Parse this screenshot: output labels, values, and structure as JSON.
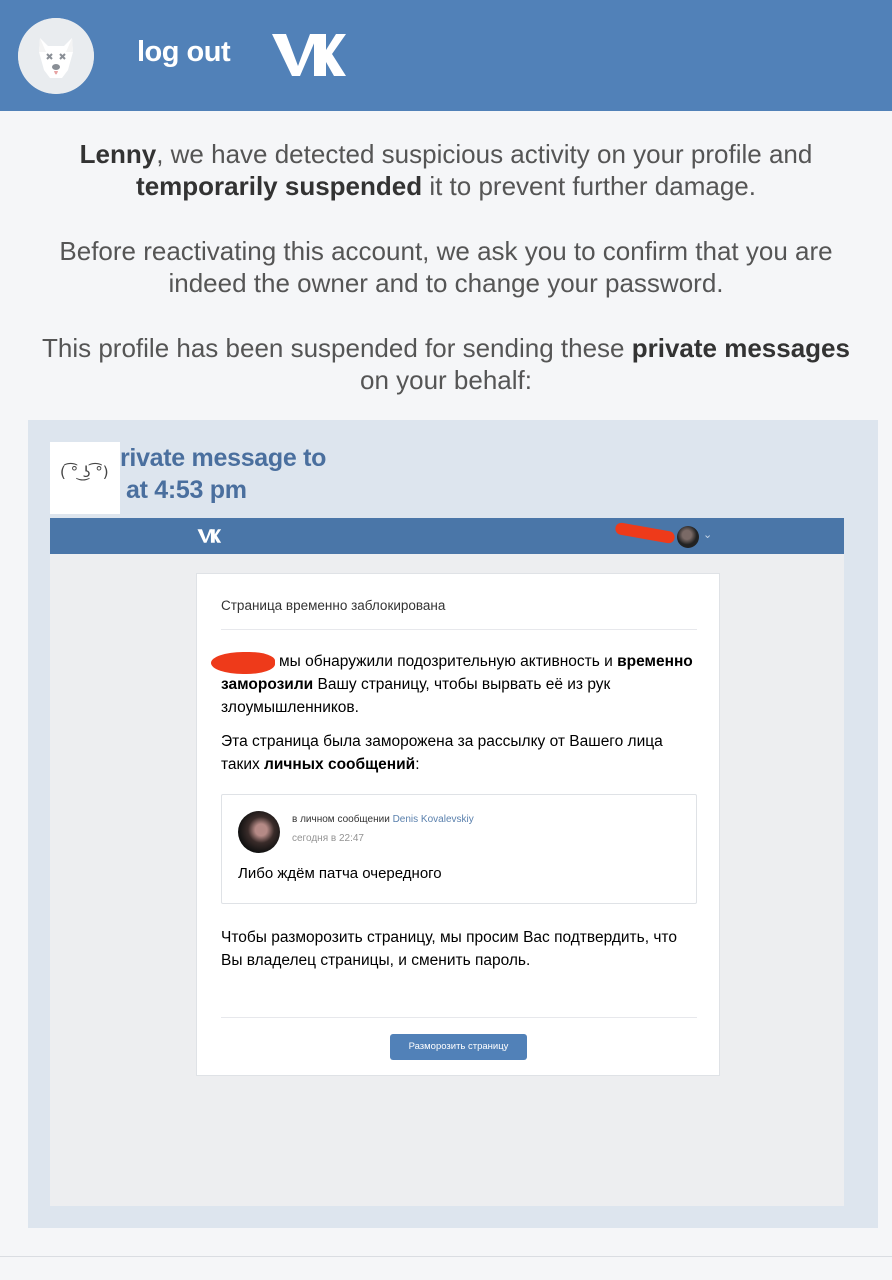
{
  "header": {
    "logout_label": "log out",
    "logo_text": "VK",
    "avatar_icon": "dog-skull-icon",
    "brand_color": "#5181b8"
  },
  "intro": {
    "line1": {
      "name": "Lenny",
      "text_a": ", we have detected suspicious activity on your profile and",
      "bold": "temporarily suspended",
      "text_b": " it to prevent further damage."
    },
    "line2": "Before reactivating this account, we ask you to confirm that you are indeed the owner and to change your password.",
    "line3": {
      "text_a": "This profile has been suspended for sending these ",
      "bold": "private messages",
      "text_b": " on your behalf:"
    }
  },
  "message": {
    "lenny_face": "( ͡° ͜ʖ ͡°)",
    "title": "rivate message to",
    "time": "at 4:53 pm"
  },
  "embedded": {
    "vk_logo": "VK",
    "card_title": "Страница временно заблокирована",
    "p1_a": "мы обнаружили подозрительную активность и ",
    "p1_bold": "временно заморозили",
    "p1_b": " Вашу страницу, чтобы вырвать её из рук злоумышленников.",
    "p2_a": "Эта страница была заморожена за рассылку от Вашего лица таких ",
    "p2_bold": "личных сообщений",
    "p2_b": ":",
    "quote": {
      "prefix": "в личном сообщении ",
      "name": "Denis Kovalevskiy",
      "time": "сегодня в 22:47",
      "text": "Либо ждём патча очередного"
    },
    "p3": "Чтобы разморозить страницу, мы просим Вас подтвердить, что Вы владелец страницы, и сменить пароль.",
    "button": "Разморозить страницу"
  }
}
